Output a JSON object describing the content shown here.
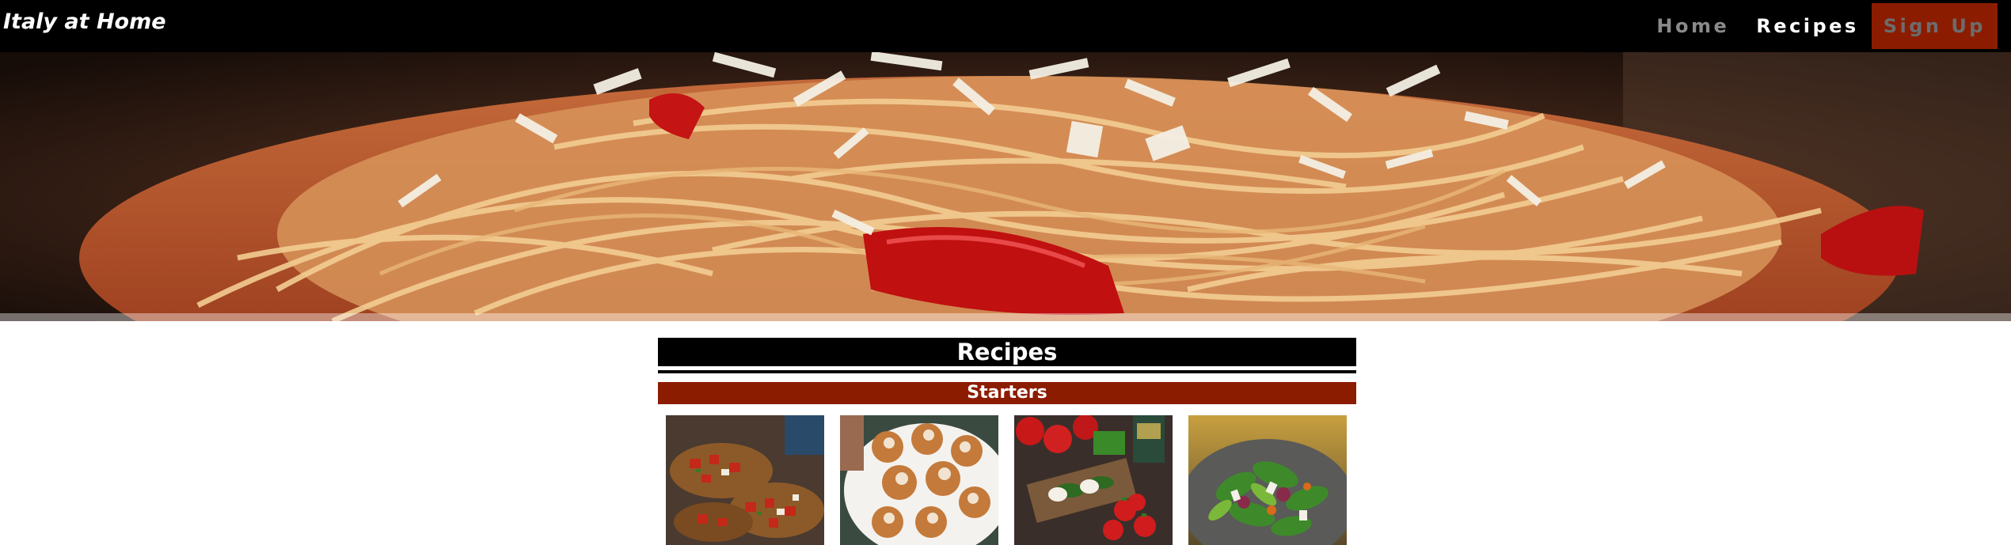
{
  "navbar": {
    "brand": "Italy at Home",
    "links": [
      {
        "label": "Home",
        "state": "inactive"
      },
      {
        "label": "Recipes",
        "state": "active"
      },
      {
        "label": "Sign Up",
        "state": "cta"
      }
    ]
  },
  "hero": {
    "image": "spaghetti-pomodoro-with-parmesan"
  },
  "main": {
    "section_title": "Recipes",
    "category_title": "Starters",
    "recipes": [
      {
        "image": "bruschetta"
      },
      {
        "image": "arancini"
      },
      {
        "image": "caprese-skewers"
      },
      {
        "image": "green-salad"
      }
    ]
  },
  "colors": {
    "nav_background": "#000000",
    "accent": "#8c1c00",
    "text_light": "#ffffff",
    "nav_inactive": "#8a8a8a"
  }
}
